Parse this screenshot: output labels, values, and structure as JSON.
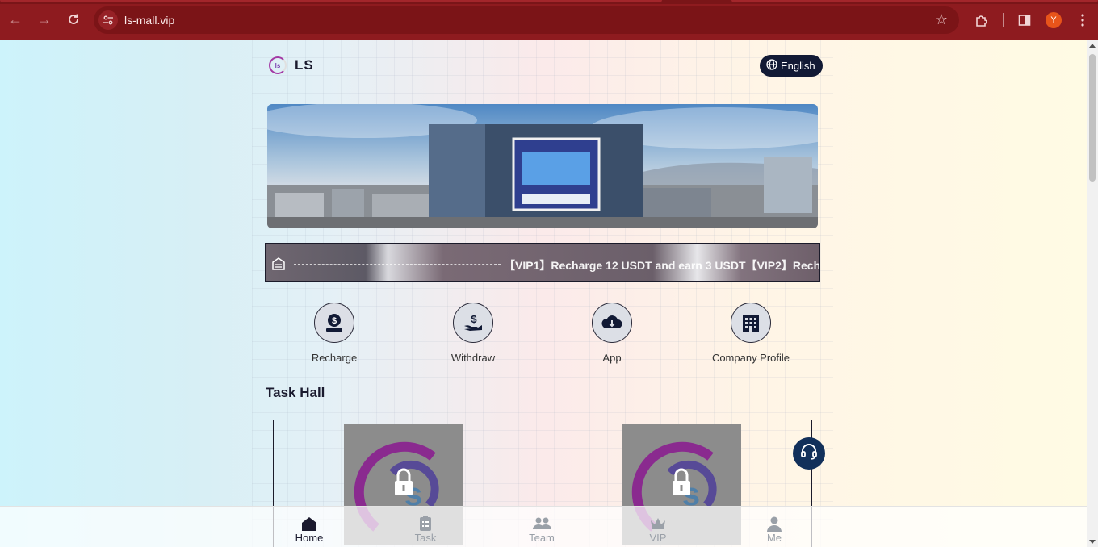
{
  "browser": {
    "url": "ls-mall.vip",
    "profile_initial": "Y"
  },
  "header": {
    "brand_name": "LS",
    "language_label": "English"
  },
  "notice": {
    "text": "【VIP1】Recharge 12 USDT and earn 3 USDT【VIP2】Rech"
  },
  "quick_actions": [
    {
      "label": "Recharge",
      "icon": "recharge-icon"
    },
    {
      "label": "Withdraw",
      "icon": "withdraw-icon"
    },
    {
      "label": "App",
      "icon": "cloud-download-icon"
    },
    {
      "label": "Company Profile",
      "icon": "building-icon"
    }
  ],
  "task_hall": {
    "title": "Task Hall",
    "cards": [
      {
        "locked": true
      },
      {
        "locked": true
      }
    ]
  },
  "tabbar": {
    "items": [
      {
        "label": "Home",
        "icon": "home-icon",
        "active": true
      },
      {
        "label": "Task",
        "icon": "clipboard-icon",
        "active": false
      },
      {
        "label": "Team",
        "icon": "team-icon",
        "active": false
      },
      {
        "label": "VIP",
        "icon": "crown-icon",
        "active": false
      },
      {
        "label": "Me",
        "icon": "user-icon",
        "active": false
      }
    ]
  },
  "colors": {
    "chrome": "#8e1b1f",
    "primary_dark": "#121a35",
    "support_button": "#12305a"
  }
}
